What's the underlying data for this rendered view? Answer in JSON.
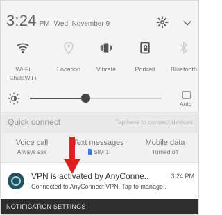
{
  "statusbar": {
    "time": "3:24",
    "ampm": "PM",
    "date": "Wed, November 9",
    "icons": {
      "settings": "gear-icon",
      "expand": "chevron-down-icon"
    }
  },
  "quick_tiles": [
    {
      "label": "Wi-Fi",
      "sublabel": "ChulaWiFi",
      "icon": "wifi-icon"
    },
    {
      "label": "Location",
      "sublabel": "",
      "icon": "location-icon"
    },
    {
      "label": "Vibrate",
      "sublabel": "",
      "icon": "vibrate-icon"
    },
    {
      "label": "Portrait",
      "sublabel": "",
      "icon": "portrait-lock-icon"
    },
    {
      "label": "Bluetooth",
      "sublabel": "",
      "icon": "bluetooth-icon"
    }
  ],
  "brightness": {
    "level": 0.42,
    "auto_label": "Auto"
  },
  "quick_connect": {
    "title": "Quick connect",
    "hint": "Tap here to connect devices"
  },
  "options": [
    {
      "title": "Voice call",
      "subtitle": "Always ask"
    },
    {
      "title": "Text messages",
      "subtitle": "SIM 1"
    },
    {
      "title": "Mobile data",
      "subtitle": "Turned off"
    }
  ],
  "notification": {
    "title": "VPN is activated by AnyConne..",
    "time": "3:24 PM",
    "text": "Connected to AnyConnect VPN. Tap to manage..",
    "icon": "anyconnect-icon"
  },
  "footer": {
    "label": "NOTIFICATION SETTINGS"
  },
  "colors": {
    "arrow": "#e02020",
    "accent": "#3a7bd5"
  }
}
